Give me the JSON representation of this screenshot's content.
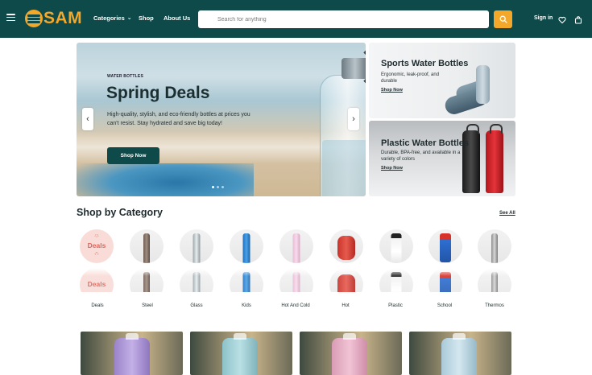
{
  "nav": {
    "logo_text": "SAM",
    "links": [
      "Categories",
      "Shop",
      "About Us"
    ],
    "search_placeholder": "Search for anything",
    "signin_label": "Sign in",
    "accent_color": "#f4a82a",
    "bg_color": "#0f4a4a",
    "icons": [
      "menu-icon",
      "search-icon",
      "heart-icon",
      "bag-icon"
    ]
  },
  "hero": {
    "tag": "WATER BOTTLES",
    "title": "Spring Deals",
    "description": "High-quality, stylish, and eco-friendly bottles at prices you can't resist. Stay hydrated and save big today!",
    "button_label": "Shop Now",
    "prev_arrow": "‹",
    "next_arrow": "›",
    "slide_count": 3,
    "active_slide": 1
  },
  "promos": [
    {
      "title": "Sports Water Bottles",
      "description": "Ergonomic, leak-proof, and durable",
      "link": "Shop Now"
    },
    {
      "title": "Plastic Water Bottles",
      "description": "Durable, BPA-free, and available in a variety of colors",
      "link": "Shop Now"
    }
  ],
  "categories": {
    "title": "Shop by Category",
    "see_all": "See All",
    "deals_badge": "Deals",
    "items": [
      "Deals",
      "Steel",
      "Glass",
      "Kids",
      "Hot And Cold",
      "Hot",
      "Plastic",
      "School",
      "Thermos"
    ]
  }
}
